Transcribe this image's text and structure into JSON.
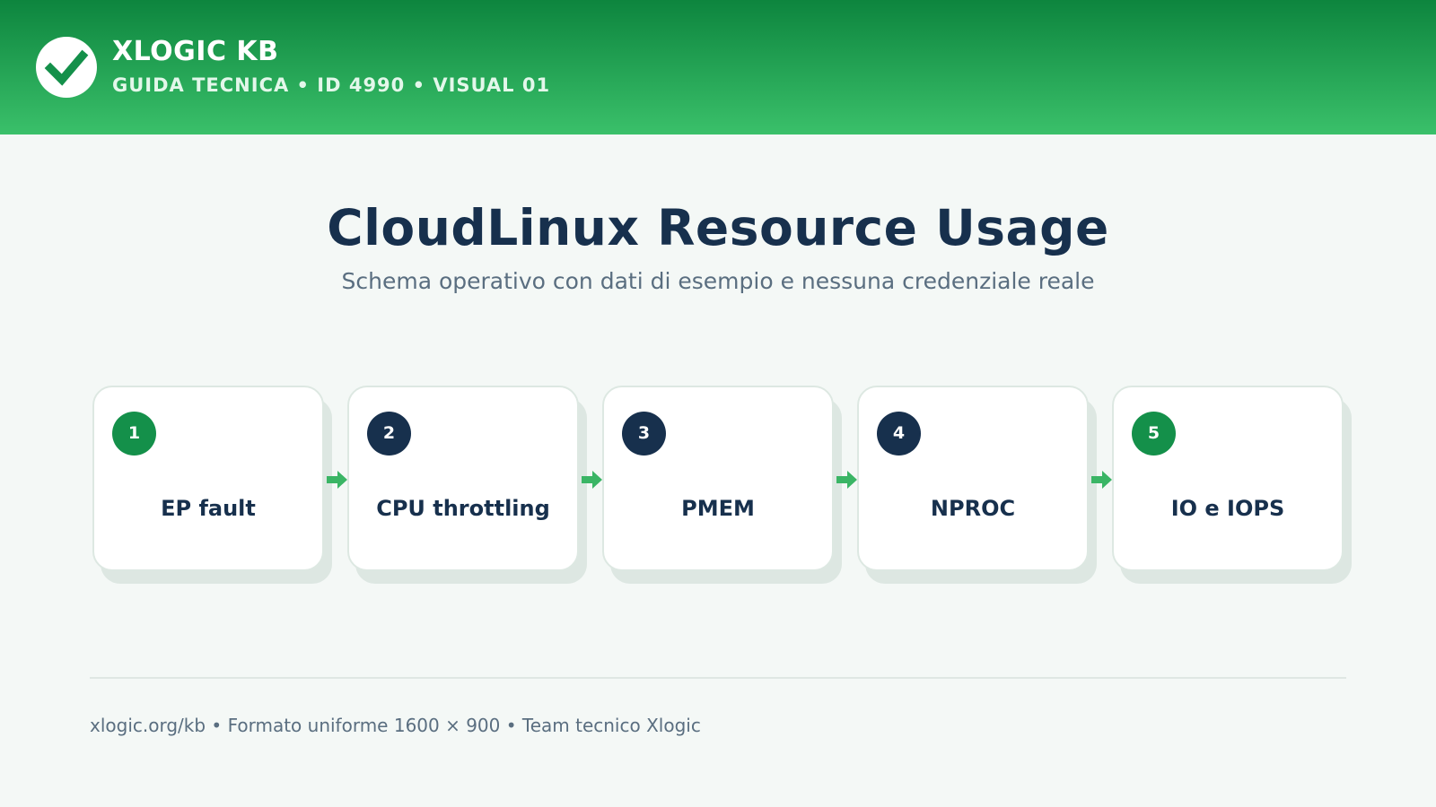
{
  "header": {
    "logo_icon": "check-icon",
    "brand": "XLOGIC KB",
    "subtitle": "GUIDA TECNICA • ID 4990 • VISUAL 01"
  },
  "main": {
    "title": "CloudLinux Resource Usage",
    "subtitle": "Schema operativo con dati di esempio e nessuna credenziale reale"
  },
  "steps": [
    {
      "number": "1",
      "label": "EP fault",
      "badge_color": "#14904a"
    },
    {
      "number": "2",
      "label": "CPU throttling",
      "badge_color": "#17304d"
    },
    {
      "number": "3",
      "label": "PMEM",
      "badge_color": "#17304d"
    },
    {
      "number": "4",
      "label": "NPROC",
      "badge_color": "#17304d"
    },
    {
      "number": "5",
      "label": "IO e IOPS",
      "badge_color": "#14904a"
    }
  ],
  "colors": {
    "header_top": "#0d853e",
    "header_bottom": "#3ac06a",
    "accent_green": "#14904a",
    "arrow_green": "#3ab565",
    "navy": "#17304d",
    "background": "#f4f8f6"
  },
  "footer": {
    "text": "xlogic.org/kb • Formato uniforme 1600 × 900 • Team tecnico Xlogic"
  }
}
